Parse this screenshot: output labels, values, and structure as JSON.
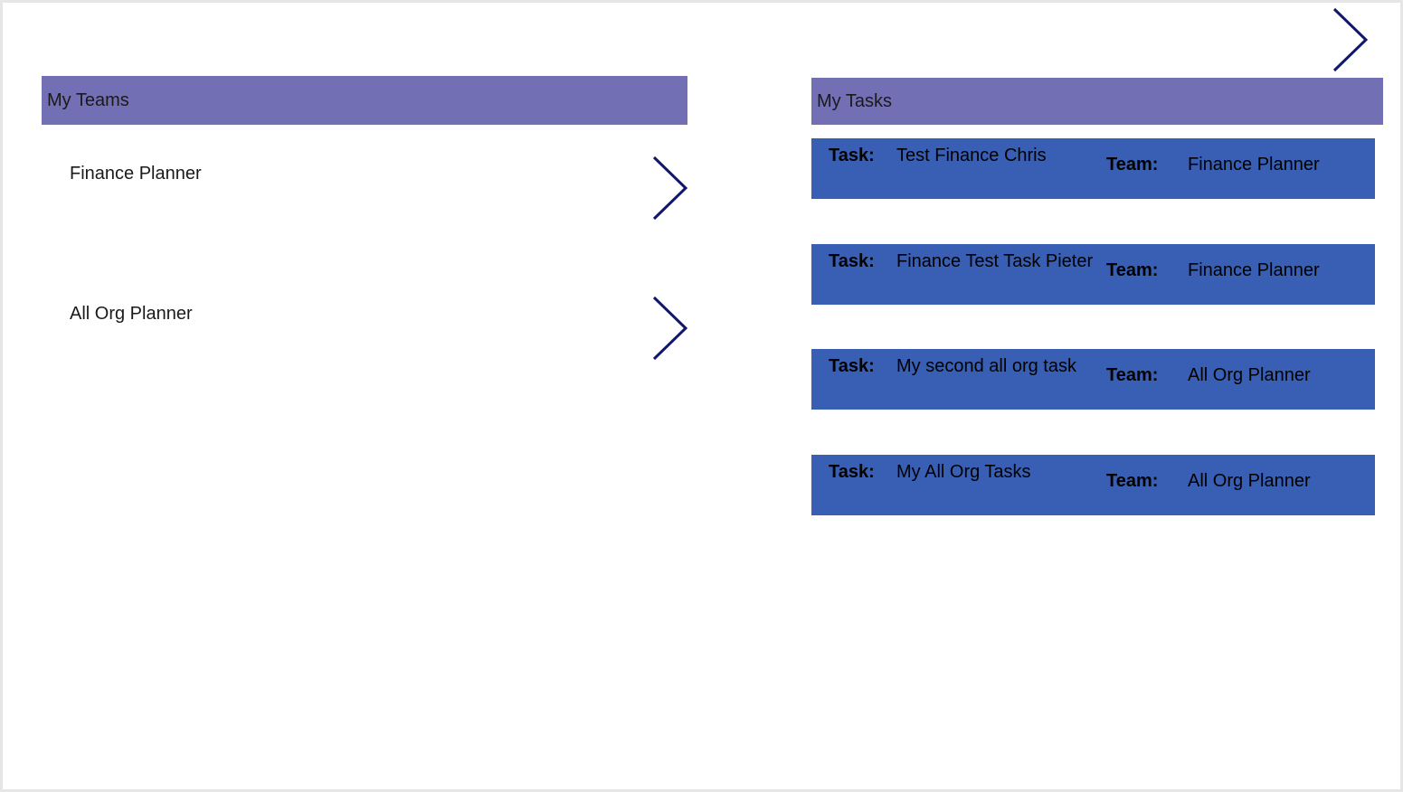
{
  "colors": {
    "header_bg": "#736fb5",
    "card_bg": "#385fb3",
    "chevron": "#10186e",
    "canvas_bg": "#ffffff",
    "frame": "#e6e6e6"
  },
  "nav": {
    "next_icon": "chevron-right-icon"
  },
  "teams": {
    "header": "My Teams",
    "items": [
      {
        "label": "Finance Planner",
        "icon": "chevron-right-icon"
      },
      {
        "label": "All Org Planner",
        "icon": "chevron-right-icon"
      }
    ]
  },
  "tasks": {
    "header": "My Tasks",
    "task_label": "Task:",
    "team_label": "Team:",
    "items": [
      {
        "task": "Test Finance Chris",
        "team": "Finance Planner"
      },
      {
        "task": "Finance Test Task Pieter",
        "team": "Finance Planner"
      },
      {
        "task": "My second all org task",
        "team": "All Org Planner"
      },
      {
        "task": "My All Org Tasks",
        "team": "All Org Planner"
      }
    ]
  }
}
